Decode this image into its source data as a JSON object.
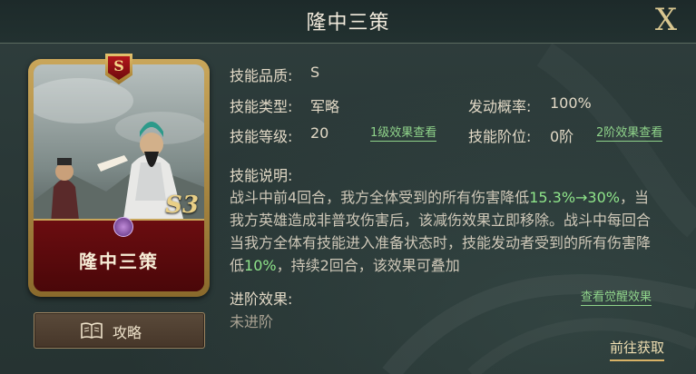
{
  "window": {
    "title": "隆中三策",
    "close_label": "X"
  },
  "card": {
    "name": "隆中三策",
    "rank_badge": "S",
    "grade_mark": "S3",
    "icons": {
      "gem": "purple-gem-icon",
      "badge": "rank-shield-icon"
    }
  },
  "guide_button": {
    "label": "攻略",
    "icon": "book-icon"
  },
  "skill": {
    "quality_label": "技能品质:",
    "quality_value": "S",
    "type_label": "技能类型:",
    "type_value": "军略",
    "trigger_label": "发动概率:",
    "trigger_value": "100%",
    "level_label": "技能等级:",
    "level_value": "20",
    "level1_effect_button": "1级效果查看",
    "stage_label": "技能阶位:",
    "stage_value": "0阶",
    "stage2_effect_button": "2阶效果查看",
    "desc_label": "技能说明:",
    "desc": {
      "p1_a": "战斗中前4回合，我方全体受到的所有伤害降低",
      "p1_hl": "15.3%→30%",
      "p1_b": "，当我方英雄造成非普攻伤害后，该减伤效果立即移除。",
      "p2_a": "战斗中每回合当我方全体有技能进入准备状态时，技能发动者受到的所有伤害降低",
      "p2_hl": "10%",
      "p2_b": "，持续2回合，该效果可叠加"
    },
    "advance_label": "进阶效果:",
    "advance_value": "未进阶",
    "awaken_button": "查看觉醒效果"
  },
  "goto_button": "前往获取",
  "colors": {
    "highlight": "#8fe58a",
    "gold": "#d9c790",
    "text": "#e2d9c6",
    "card_red": "#6b0d10"
  }
}
